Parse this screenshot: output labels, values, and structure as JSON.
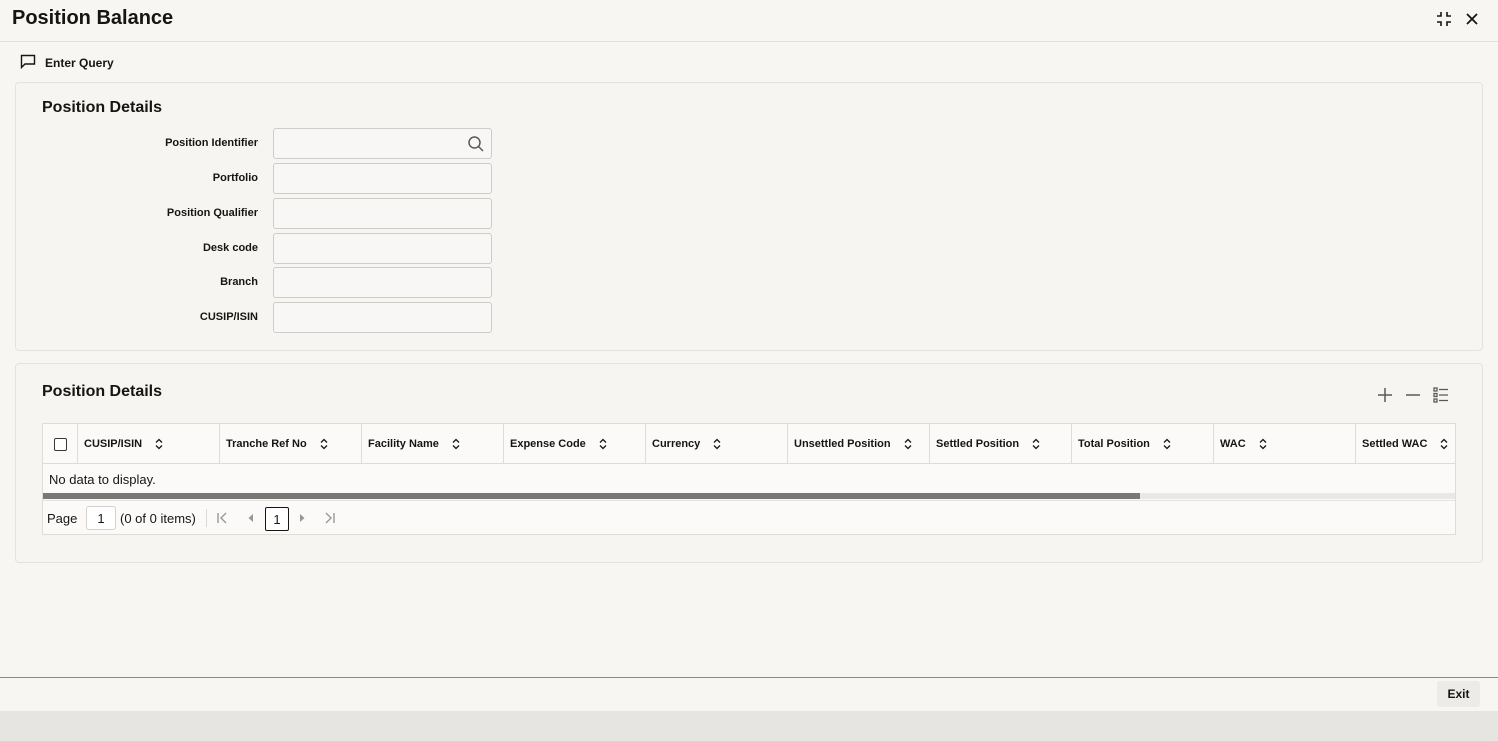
{
  "window": {
    "title": "Position Balance",
    "maximize_icon": "collapse-arrows-icon",
    "close_icon": "close-icon"
  },
  "toolbar": {
    "enter_query_label": "Enter Query",
    "enter_query_icon": "chat-bubble-icon"
  },
  "query_panel": {
    "title": "Position Details",
    "fields": [
      {
        "label": "Position Identifier",
        "value": "",
        "has_search": true
      },
      {
        "label": "Portfolio",
        "value": ""
      },
      {
        "label": "Position Qualifier",
        "value": ""
      },
      {
        "label": "Desk code",
        "value": ""
      },
      {
        "label": "Branch",
        "value": ""
      },
      {
        "label": "CUSIP/ISIN",
        "value": ""
      }
    ]
  },
  "grid_panel": {
    "title": "Position Details",
    "actions": [
      "add-icon",
      "remove-icon",
      "list-view-icon"
    ],
    "columns": [
      "CUSIP/ISIN",
      "Tranche Ref No",
      "Facility Name",
      "Expense Code",
      "Currency",
      "Unsettled Position",
      "Settled Position",
      "Total Position",
      "WAC",
      "Settled WAC"
    ],
    "empty_message": "No data to display.",
    "pager": {
      "label": "Page",
      "page_value": "1",
      "count_text": "(0 of 0 items)",
      "current_page": "1"
    }
  },
  "footer": {
    "exit_label": "Exit"
  },
  "colors": {
    "background": "#f7f6f3",
    "text": "#161513",
    "border": "#dedcd8",
    "scrollbar_thumb": "#7a7875"
  }
}
